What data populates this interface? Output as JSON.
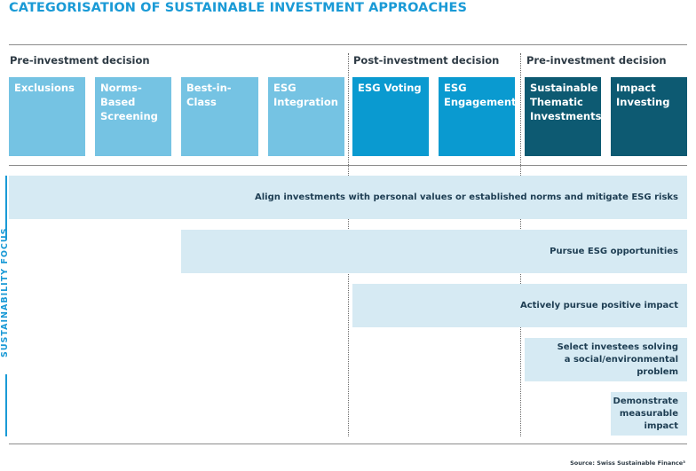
{
  "title": "CATEGORISATION OF SUSTAINABLE INVESTMENT APPROACHES",
  "phases": [
    {
      "label": "Pre-investment decision"
    },
    {
      "label": "Post-investment decision"
    },
    {
      "label": "Pre-investment decision"
    }
  ],
  "approaches": [
    {
      "label": "Exclusions",
      "color": "#75c3e3"
    },
    {
      "label": "Norms-Based Screening",
      "color": "#75c3e3"
    },
    {
      "label": "Best-in-Class",
      "color": "#75c3e3"
    },
    {
      "label": "ESG Integration",
      "color": "#75c3e3"
    },
    {
      "label": "ESG Voting",
      "color": "#0a9ad0"
    },
    {
      "label": "ESG Engagement",
      "color": "#0a9ad0"
    },
    {
      "label": "Sustainable Thematic Investments",
      "color": "#0d5a72"
    },
    {
      "label": "Impact Investing",
      "color": "#0d5a72"
    }
  ],
  "sustainability_focus": {
    "axis_label": "SUSTAINABILITY FOCUS",
    "bands": [
      {
        "label": "Align investments with personal values or established norms and mitigate ESG risks"
      },
      {
        "label": "Pursue ESG opportunities"
      },
      {
        "label": "Actively pursue positive impact"
      },
      {
        "label": "Select investees solving\na social/environmental problem"
      },
      {
        "label": "Demonstrate\nmeasurable\nimpact"
      }
    ]
  },
  "source": "Source: Swiss Sustainable Finance³",
  "colors": {
    "title": "#1a9ad6",
    "light_blue": "#75c3e3",
    "mid_blue": "#0a9ad0",
    "dark_teal": "#0d5a72",
    "band_bg": "#d6eaf3"
  }
}
